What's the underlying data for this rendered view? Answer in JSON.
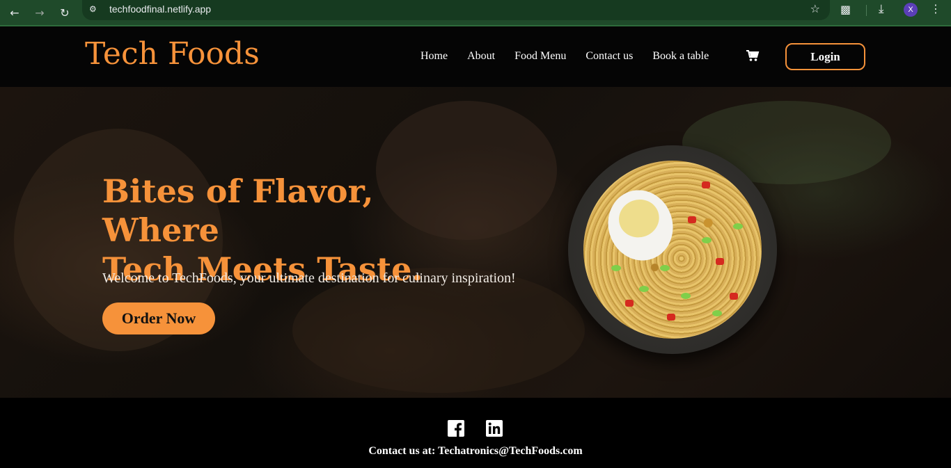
{
  "browser": {
    "url": "techfoodfinal.netlify.app",
    "profile_initial": "X"
  },
  "header": {
    "brand": "Tech Foods",
    "nav": [
      "Home",
      "About",
      "Food Menu",
      "Contact us",
      "Book a table"
    ],
    "login_label": "Login"
  },
  "hero": {
    "headline_line1": "Bites of Flavor, Where",
    "headline_line2": "Tech Meets Taste.",
    "welcome": "Welcome to TechFoods, your ultimate destination for culinary inspiration!",
    "order_label": "Order Now"
  },
  "footer": {
    "contact": "Contact us at: Techatronics@TechFoods.com"
  },
  "colors": {
    "accent": "#f6923a",
    "header_bg": "#050505",
    "browser_bar": "#1f4a2a"
  }
}
